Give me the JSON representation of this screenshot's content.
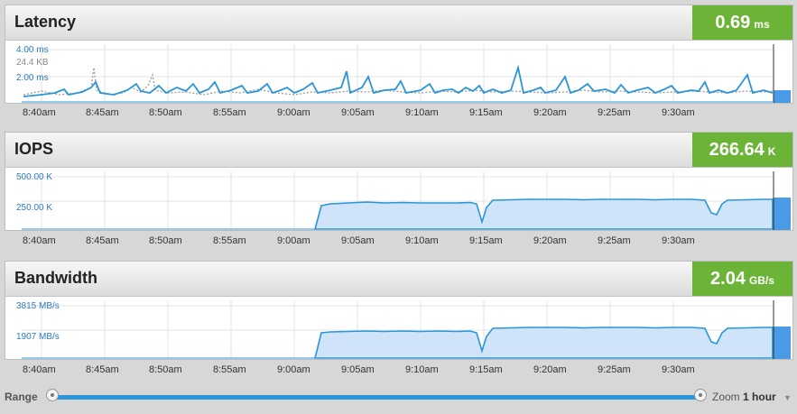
{
  "time_ticks": [
    "8:40am",
    "8:45am",
    "8:50am",
    "8:55am",
    "9:00am",
    "9:05am",
    "9:10am",
    "9:15am",
    "9:20am",
    "9:25am",
    "9:30am"
  ],
  "panels": [
    {
      "title": "Latency",
      "metric_value": "0.69",
      "metric_unit": "ms",
      "y_labels": [
        "4.00 ms",
        "24.4 KB",
        "2.00 ms"
      ]
    },
    {
      "title": "IOPS",
      "metric_value": "266.64",
      "metric_unit": "K",
      "y_labels": [
        "500.00 K",
        "250.00 K"
      ]
    },
    {
      "title": "Bandwidth",
      "metric_value": "2.04",
      "metric_unit": "GB/s",
      "y_labels": [
        "3815 MB/s",
        "1907 MB/s"
      ]
    }
  ],
  "range": {
    "label": "Range",
    "zoom_label": "Zoom",
    "zoom_value": "1 hour",
    "start_fraction": 0.0,
    "end_fraction": 1.0
  },
  "colors": {
    "metric_bg": "#6cb437",
    "series_line": "#2a95d8",
    "area_fill": "#cfe4f8",
    "secondary_line": "#9a9a9a"
  }
}
